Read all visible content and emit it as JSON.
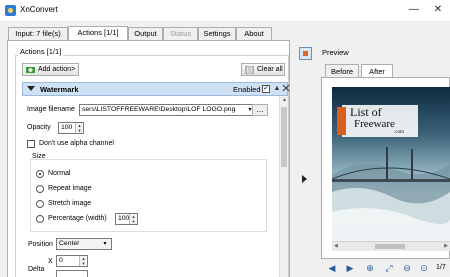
{
  "window": {
    "title": "XnConvert",
    "minimize": "—",
    "close": "✕"
  },
  "tabs": [
    {
      "label": "Input: 7 file(s)"
    },
    {
      "label": "Actions [1/1]"
    },
    {
      "label": "Output"
    },
    {
      "label": "Status"
    },
    {
      "label": "Settings"
    },
    {
      "label": "About"
    }
  ],
  "actions": {
    "group_label": "Actions [1/1]",
    "add_action": "Add action>",
    "clear_all": "Clear all"
  },
  "watermark": {
    "title": "Watermark",
    "enabled_label": "Enabled",
    "enabled_check": "✓",
    "image_filename_label": "Image filename",
    "image_filename_value": "sers\\LISTOFFREEWARE\\Desktop\\LOF LOGO.png",
    "browse_label": "...",
    "opacity_label": "Opacity",
    "opacity_value": "100",
    "alpha_label": "Don't use alpha channel",
    "size_label": "Size",
    "size_options": [
      {
        "label": "Normal",
        "selected": true
      },
      {
        "label": "Repeat image",
        "selected": false
      },
      {
        "label": "Stretch image",
        "selected": false
      },
      {
        "label": "Percentage (width)",
        "selected": false
      }
    ],
    "percentage_value": "100%",
    "position_label": "Position",
    "position_value": "Center",
    "delta_label": "Delta",
    "x_label": "X",
    "x_value": "0"
  },
  "preview": {
    "label": "Preview",
    "tabs": [
      {
        "label": "Before"
      },
      {
        "label": "After"
      }
    ],
    "watermark_line1": "List of",
    "watermark_line2": "Freeware",
    "watermark_line3": ".com",
    "page_count": "1/7"
  },
  "spin_up": "▲",
  "spin_down": "▼",
  "combo_arrow": "▾",
  "toolbar_icons": [
    "◀",
    "▶",
    "⊕",
    "⤢",
    "⊖",
    "⊙",
    "⊡"
  ]
}
